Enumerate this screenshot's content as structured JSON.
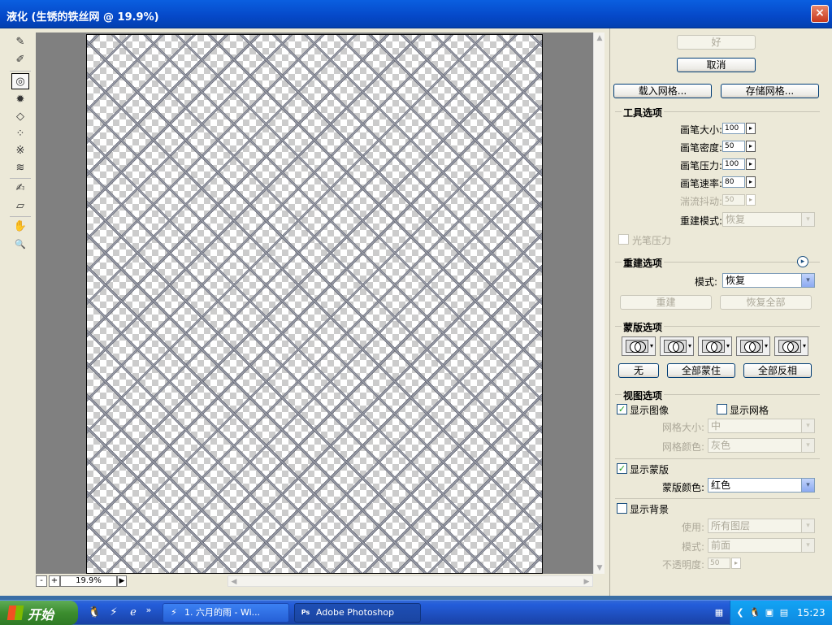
{
  "window": {
    "title": "液化 (生锈的铁丝网 @ 19.9%)",
    "close_glyph": "×"
  },
  "tools": [
    {
      "name": "forward-warp-tool",
      "glyph": "✎"
    },
    {
      "name": "reconstruct-tool",
      "glyph": "✐"
    },
    {
      "name": "twirl-clockwise-tool",
      "glyph": "◎"
    },
    {
      "name": "pucker-tool",
      "glyph": "✹"
    },
    {
      "name": "bloat-tool",
      "glyph": "◇"
    },
    {
      "name": "push-left-tool",
      "glyph": "⁘"
    },
    {
      "name": "mirror-tool",
      "glyph": "※"
    },
    {
      "name": "turbulence-tool",
      "glyph": "≋"
    },
    {
      "name": "freeze-mask-tool",
      "glyph": "✍"
    },
    {
      "name": "thaw-mask-tool",
      "glyph": "▱"
    },
    {
      "name": "hand-tool",
      "glyph": "✋"
    },
    {
      "name": "zoom-tool",
      "glyph": "🔍"
    }
  ],
  "status": {
    "minus": "-",
    "plus": "+",
    "zoom": "19.9%",
    "zoom_arrow": "▶"
  },
  "scroll": {
    "up": "▲",
    "down": "▼",
    "left": "◀",
    "right": "▶"
  },
  "buttons": {
    "ok": "好",
    "cancel": "取消",
    "load_mesh": "载入网格...",
    "save_mesh": "存储网格..."
  },
  "tool_options": {
    "title": "工具选项",
    "brush_size_label": "画笔大小:",
    "brush_size": "100",
    "brush_density_label": "画笔密度:",
    "brush_density": "50",
    "brush_pressure_label": "画笔压力:",
    "brush_pressure": "100",
    "brush_rate_label": "画笔速率:",
    "brush_rate": "80",
    "turbulent_jitter_label": "湍流抖动:",
    "turbulent_jitter": "50",
    "reconstruct_mode_label": "重建模式:",
    "reconstruct_mode": "恢复",
    "stylus_pressure_label": "光笔压力",
    "arrow": "▸"
  },
  "reconstruct_options": {
    "title": "重建选项",
    "mode_label": "模式:",
    "mode": "恢复",
    "reconstruct": "重建",
    "restore_all": "恢复全部",
    "info_icon": "▸"
  },
  "mask_options": {
    "title": "蒙版选项",
    "none": "无",
    "mask_all": "全部蒙住",
    "invert_all": "全部反相"
  },
  "view_options": {
    "title": "视图选项",
    "show_image": "显示图像",
    "show_mesh": "显示网格",
    "mesh_size_label": "网格大小:",
    "mesh_size": "中",
    "mesh_color_label": "网格颜色:",
    "mesh_color": "灰色",
    "show_mask": "显示蒙版",
    "mask_color_label": "蒙版颜色:",
    "mask_color": "红色",
    "show_backdrop": "显示背景",
    "use_label": "使用:",
    "use": "所有图层",
    "mode_label": "模式:",
    "mode": "前面",
    "opacity_label": "不透明度:",
    "opacity": "50",
    "check": "✓",
    "dd": "▾"
  },
  "taskbar": {
    "start": "开始",
    "quicklaunch": [
      "🐧",
      "⚡",
      "ℯ"
    ],
    "chevron": "»",
    "tasks": [
      {
        "label": "1. 六月的雨 - Wi...",
        "icon": "⚡"
      },
      {
        "label": "Adobe Photoshop",
        "icon": "Ps"
      }
    ],
    "tray_icons": [
      "▦",
      "❮",
      "🐧",
      "▣",
      "▤"
    ],
    "clock": "15:23"
  }
}
